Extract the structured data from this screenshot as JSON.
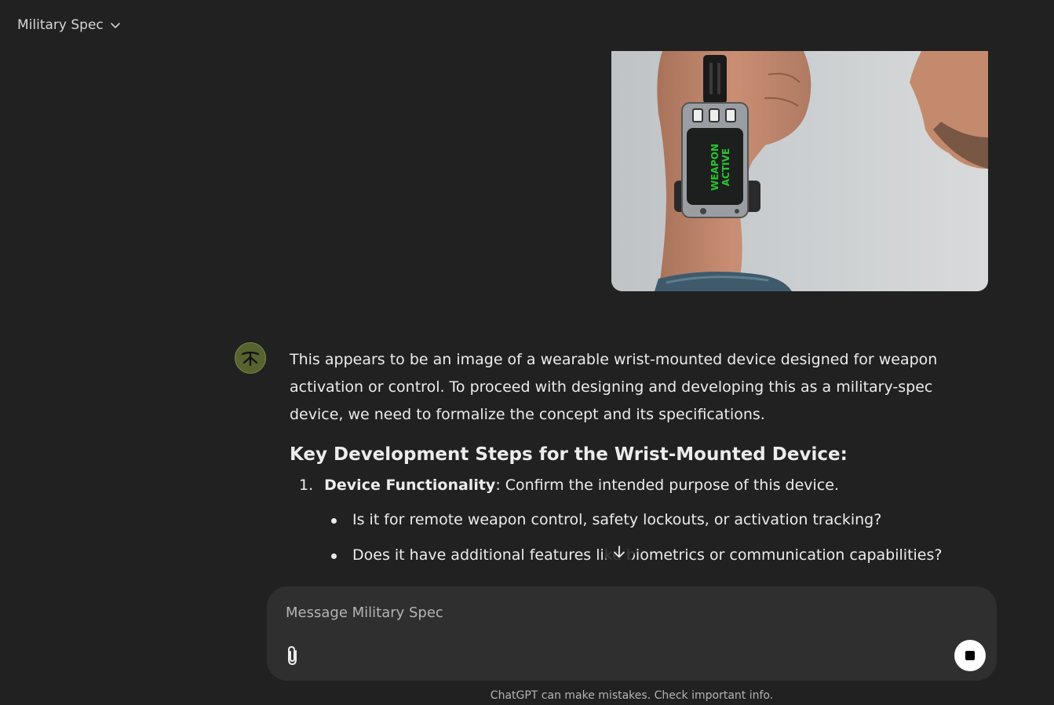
{
  "header": {
    "model_name": "Military Spec"
  },
  "attachment": {
    "device_text_line1": "WEAPON",
    "device_text_line2": "ACTIVE",
    "screen_text_color": "#29c42f"
  },
  "assistant_message": {
    "intro": "This appears to be an image of a wearable wrist-mounted device designed for weapon activation or control. To proceed with designing and developing this as a military-spec device, we need to formalize the concept and its specifications.",
    "heading": "Key Development Steps for the Wrist-Mounted Device:",
    "steps": [
      {
        "number": "1.",
        "title": "Device Functionality",
        "text": ": Confirm the intended purpose of this device.",
        "bullets": [
          "Is it for remote weapon control, safety lockouts, or activation tracking?",
          "Does it have additional features like biometrics or communication capabilities?"
        ]
      }
    ]
  },
  "composer": {
    "placeholder": "Message Military Spec",
    "attach_icon": "paperclip-icon",
    "stop_icon": "stop-icon"
  },
  "footer": {
    "disclaimer": "ChatGPT can make mistakes. Check important info."
  },
  "colors": {
    "background": "#212121",
    "composer": "#2f2f2f",
    "avatar": "#56632f"
  }
}
